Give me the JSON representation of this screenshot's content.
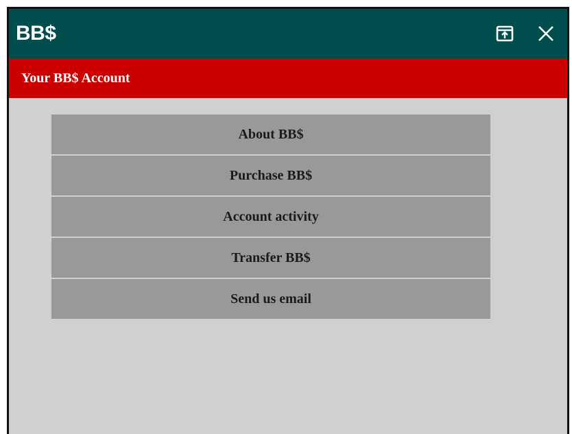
{
  "window": {
    "title": "BB$",
    "controls": [
      {
        "name": "popout-icon"
      },
      {
        "name": "close-icon"
      }
    ]
  },
  "header": {
    "title": "Your BB$ Account"
  },
  "menu": {
    "items": [
      {
        "label": "About BB$"
      },
      {
        "label": "Purchase BB$"
      },
      {
        "label": "Account activity"
      },
      {
        "label": "Transfer BB$"
      },
      {
        "label": "Send us email"
      }
    ]
  },
  "colors": {
    "titlebar": "#004d4d",
    "header": "#cc0000",
    "background": "#d0d0d0",
    "menu_item": "#999999"
  }
}
